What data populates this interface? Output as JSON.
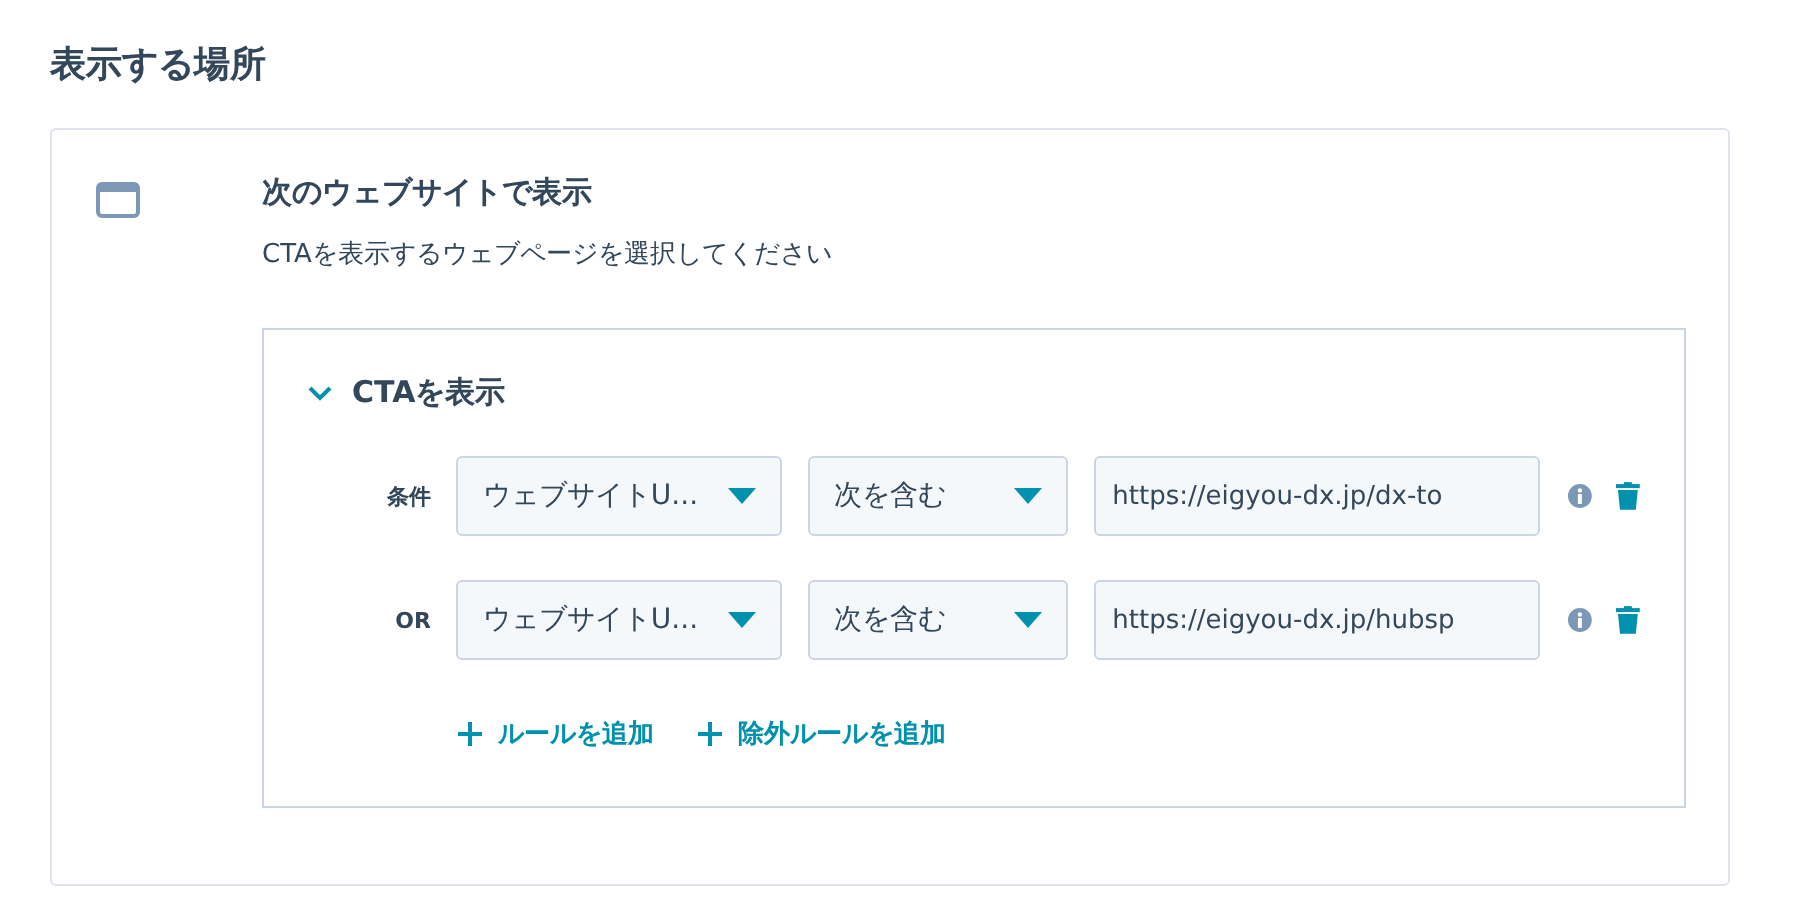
{
  "heading": "表示する場所",
  "section": {
    "title": "次のウェブサイトで表示",
    "description": "CTAを表示するウェブページを選択してください",
    "group": {
      "title": "CTAを表示",
      "expanded": true,
      "rules": [
        {
          "label": "条件",
          "property": "ウェブサイトU...",
          "operator": "次を含む",
          "value": "https://eigyou-dx.jp/dx-to"
        },
        {
          "label": "OR",
          "property": "ウェブサイトU...",
          "operator": "次を含む",
          "value": "https://eigyou-dx.jp/hubsp"
        }
      ],
      "actions": [
        {
          "label": "ルールを追加"
        },
        {
          "label": "除外ルールを追加"
        }
      ]
    }
  }
}
